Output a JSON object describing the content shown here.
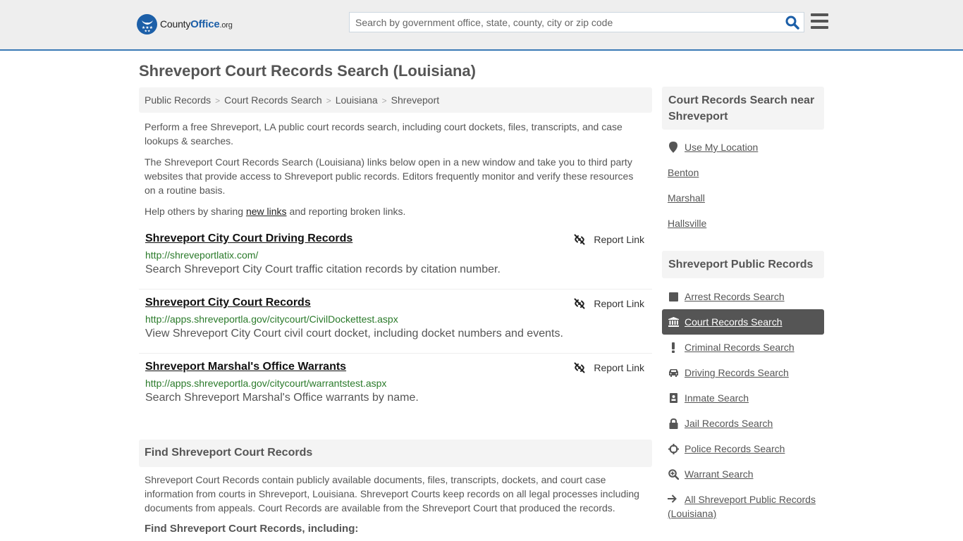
{
  "header": {
    "logo": {
      "name_part1": "County",
      "name_part2": "Office",
      "tld": ".org"
    },
    "search": {
      "placeholder": "Search by government office, state, county, city or zip code",
      "value": ""
    },
    "colors": {
      "brand": "#1c5fa8",
      "header_border": "#3a7ab5"
    }
  },
  "page": {
    "title": "Shreveport Court Records Search (Louisiana)"
  },
  "breadcrumb": [
    {
      "label": "Public Records"
    },
    {
      "label": "Court Records Search"
    },
    {
      "label": "Louisiana"
    },
    {
      "label": "Shreveport"
    }
  ],
  "breadcrumb_separator": ">",
  "intro": {
    "p1": "Perform a free Shreveport, LA public court records search, including court dockets, files, transcripts, and case lookups & searches.",
    "p2": "The Shreveport Court Records Search (Louisiana) links below open in a new window and take you to third party websites that provide access to Shreveport public records. Editors frequently monitor and verify these resources on a routine basis.",
    "p3_before": "Help others by sharing ",
    "p3_link": "new links",
    "p3_after": " and reporting broken links."
  },
  "results": [
    {
      "title": "Shreveport City Court Driving Records",
      "url": "http://shreveportlatix.com/",
      "description": "Search Shreveport City Court traffic citation records by citation number.",
      "report_label": "Report Link"
    },
    {
      "title": "Shreveport City Court Records",
      "url": "http://apps.shreveportla.gov/citycourt/CivilDockettest.aspx",
      "description": "View Shreveport City Court civil court docket, including docket numbers and events.",
      "report_label": "Report Link"
    },
    {
      "title": "Shreveport Marshal's Office Warrants",
      "url": "http://apps.shreveportla.gov/citycourt/warrantstest.aspx",
      "description": "Search Shreveport Marshal's Office warrants by name.",
      "report_label": "Report Link"
    }
  ],
  "find_section": {
    "heading": "Find Shreveport Court Records",
    "body": "Shreveport Court Records contain publicly available documents, files, transcripts, dockets, and court case information from courts in Shreveport, Louisiana. Shreveport Courts keep records on all legal processes including documents from appeals. Court Records are available from the Shreveport Court that produced the records.",
    "subheading": "Find Shreveport Court Records, including:"
  },
  "sidebar": {
    "nearby": {
      "heading": "Court Records Search near Shreveport",
      "use_location": "Use My Location",
      "places": [
        "Benton",
        "Marshall",
        "Hallsville"
      ]
    },
    "public_records": {
      "heading": "Shreveport Public Records",
      "items": [
        {
          "label": "Arrest Records Search",
          "icon": "square-icon",
          "active": false
        },
        {
          "label": "Court Records Search",
          "icon": "courthouse-icon",
          "active": true
        },
        {
          "label": "Criminal Records Search",
          "icon": "exclamation-icon",
          "active": false
        },
        {
          "label": "Driving Records Search",
          "icon": "car-icon",
          "active": false
        },
        {
          "label": "Inmate Search",
          "icon": "id-badge-icon",
          "active": false
        },
        {
          "label": "Jail Records Search",
          "icon": "lock-icon",
          "active": false
        },
        {
          "label": "Police Records Search",
          "icon": "crosshairs-icon",
          "active": false
        },
        {
          "label": "Warrant Search",
          "icon": "zoom-in-icon",
          "active": false
        }
      ],
      "all_link": "All Shreveport Public Records (Louisiana)"
    }
  }
}
